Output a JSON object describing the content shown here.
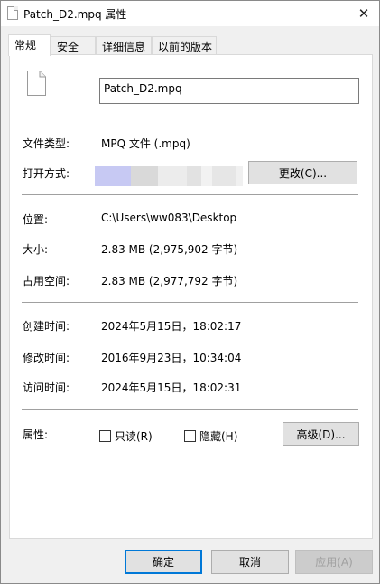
{
  "window": {
    "title": "Patch_D2.mpq 属性",
    "close_glyph": "✕"
  },
  "tabs": [
    {
      "label": "常规",
      "active": true
    },
    {
      "label": "安全",
      "active": false
    },
    {
      "label": "详细信息",
      "active": false
    },
    {
      "label": "以前的版本",
      "active": false
    }
  ],
  "general": {
    "file_name": "Patch_D2.mpq",
    "file_type_label": "文件类型:",
    "file_type_value": "MPQ 文件 (.mpq)",
    "open_with_label": "打开方式:",
    "open_with_colors": [
      "#c7c9f3",
      "#d9d9d9",
      "#ececec",
      "#e2e2e2",
      "#f2f2f2",
      "#e6e6e6",
      "#f0f0f0"
    ],
    "change_button": "更改(C)...",
    "location_label": "位置:",
    "location_value": "C:\\Users\\ww083\\Desktop",
    "size_label": "大小:",
    "size_value": "2.83 MB (2,975,902 字节)",
    "size_on_disk_label": "占用空间:",
    "size_on_disk_value": "2.83 MB (2,977,792 字节)",
    "created_label": "创建时间:",
    "created_value": "2024年5月15日，18:02:17",
    "modified_label": "修改时间:",
    "modified_value": "2016年9月23日，10:34:04",
    "accessed_label": "访问时间:",
    "accessed_value": "2024年5月15日，18:02:31",
    "attributes_label": "属性:",
    "readonly_label": "只读(R)",
    "hidden_label": "隐藏(H)",
    "advanced_button": "高级(D)..."
  },
  "footer": {
    "ok": "确定",
    "cancel": "取消",
    "apply": "应用(A)"
  }
}
